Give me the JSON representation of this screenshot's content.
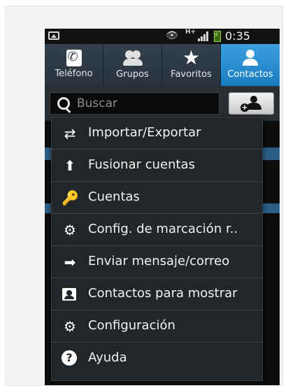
{
  "status_bar": {
    "time": "0:35",
    "network": "H+",
    "battery_color": "#9bd24a"
  },
  "tabs": [
    {
      "label": "Teléfono",
      "icon": "phone-icon",
      "active": false
    },
    {
      "label": "Grupos",
      "icon": "groups-icon",
      "active": false
    },
    {
      "label": "Favoritos",
      "icon": "star-icon",
      "active": false
    },
    {
      "label": "Contactos",
      "icon": "contact-person-icon",
      "active": true
    }
  ],
  "search": {
    "placeholder": "Buscar",
    "add_contact_icon": "add-contact-icon"
  },
  "menu": {
    "items": [
      {
        "label": "Importar/Exportar",
        "icon": "import-export-icon"
      },
      {
        "label": "Fusionar cuentas",
        "icon": "merge-arrow-icon"
      },
      {
        "label": "Cuentas",
        "icon": "key-icon"
      },
      {
        "label": "Config. de marcación r..",
        "icon": "speed-dial-settings-icon"
      },
      {
        "label": "Enviar mensaje/correo",
        "icon": "arrow-right-icon"
      },
      {
        "label": "Contactos para mostrar",
        "icon": "contact-card-icon"
      },
      {
        "label": "Configuración",
        "icon": "gear-icon"
      },
      {
        "label": "Ayuda",
        "icon": "help-icon"
      }
    ]
  },
  "colors": {
    "accent_active_tab": "#1a7cc0",
    "tab_bar": "#33414e",
    "menu_background": "#222629"
  }
}
